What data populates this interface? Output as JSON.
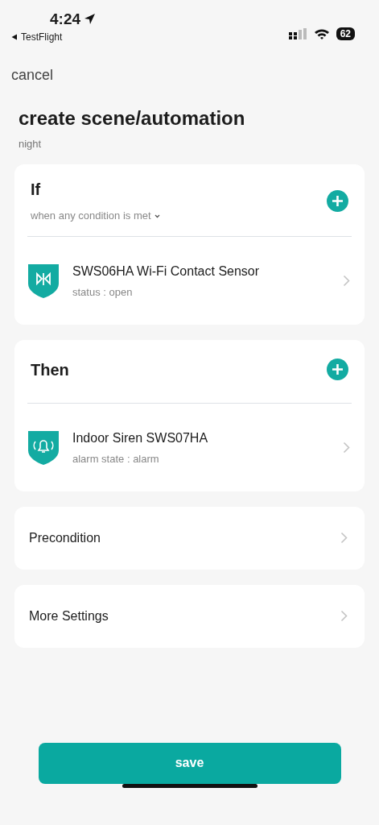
{
  "status_bar": {
    "time": "4:24",
    "back_app": "TestFlight",
    "battery": "62"
  },
  "cancel": "cancel",
  "title": "create scene/automation",
  "subtitle": "night",
  "sections": [
    {
      "kind": "devices",
      "heading": "If",
      "mode": "when any condition is met",
      "items": [
        {
          "kind": "contact",
          "name": "SWS06HA Wi-Fi Contact Sensor",
          "detail": "status : open"
        }
      ]
    },
    {
      "kind": "devices",
      "heading": "Then",
      "items": [
        {
          "kind": "siren",
          "name": "Indoor Siren SWS07HA",
          "detail": "alarm state : alarm"
        }
      ]
    },
    {
      "kind": "link",
      "label": "Precondition"
    },
    {
      "kind": "link",
      "label": "More Settings"
    }
  ],
  "save": "save"
}
